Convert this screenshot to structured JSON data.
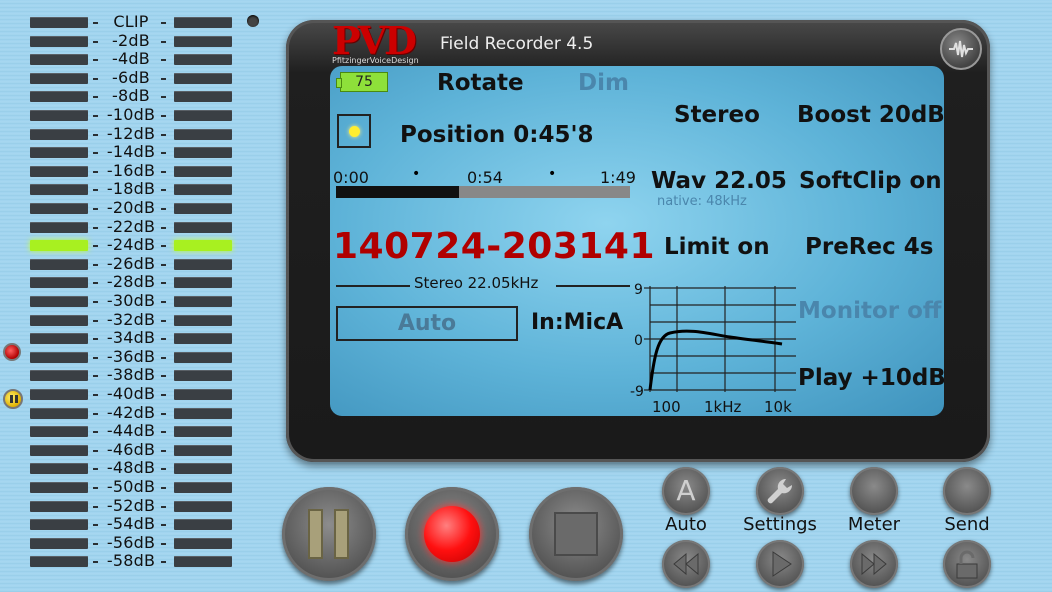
{
  "meter": {
    "labels": [
      "CLIP",
      "-2dB",
      "-4dB",
      "-6dB",
      "-8dB",
      "-10dB",
      "-12dB",
      "-14dB",
      "-16dB",
      "-18dB",
      "-20dB",
      "-22dB",
      "-24dB",
      "-26dB",
      "-28dB",
      "-30dB",
      "-32dB",
      "-34dB",
      "-36dB",
      "-38dB",
      "-40dB",
      "-42dB",
      "-44dB",
      "-46dB",
      "-48dB",
      "-50dB",
      "-52dB",
      "-54dB",
      "-56dB",
      "-58dB"
    ],
    "current_level": "-24dB",
    "lit_color": "#a8f020",
    "unlit_color": "#3a3f44"
  },
  "header": {
    "logo_text": "PVD",
    "logo_subtext": "PfitzingerVoiceDesign",
    "title": "Field Recorder 4.5"
  },
  "screen": {
    "battery": "75",
    "rotate": "Rotate",
    "dim": "Dim",
    "position": "Position 0:45'8",
    "progress": {
      "start": "0:00",
      "middle": "0:54",
      "end": "1:49",
      "fraction": 0.42
    },
    "timecode": "140724-203141",
    "format": "Stereo 22.05kHz",
    "auto": "Auto",
    "input": "In:MicA",
    "stereo": "Stereo",
    "boost": "Boost 20dB",
    "wav": "Wav 22.05",
    "native": "native: 48kHz",
    "softclip": "SoftClip on",
    "limit": "Limit on",
    "prerec": "PreRec 4s",
    "monitor": "Monitor off",
    "play": "Play +10dB",
    "eq": {
      "y_ticks": [
        "9",
        "0",
        "-9"
      ],
      "x_ticks": [
        "100",
        "1kHz",
        "10k"
      ]
    }
  },
  "controls": {
    "auto": "Auto",
    "settings": "Settings",
    "meter": "Meter",
    "send": "Send"
  }
}
